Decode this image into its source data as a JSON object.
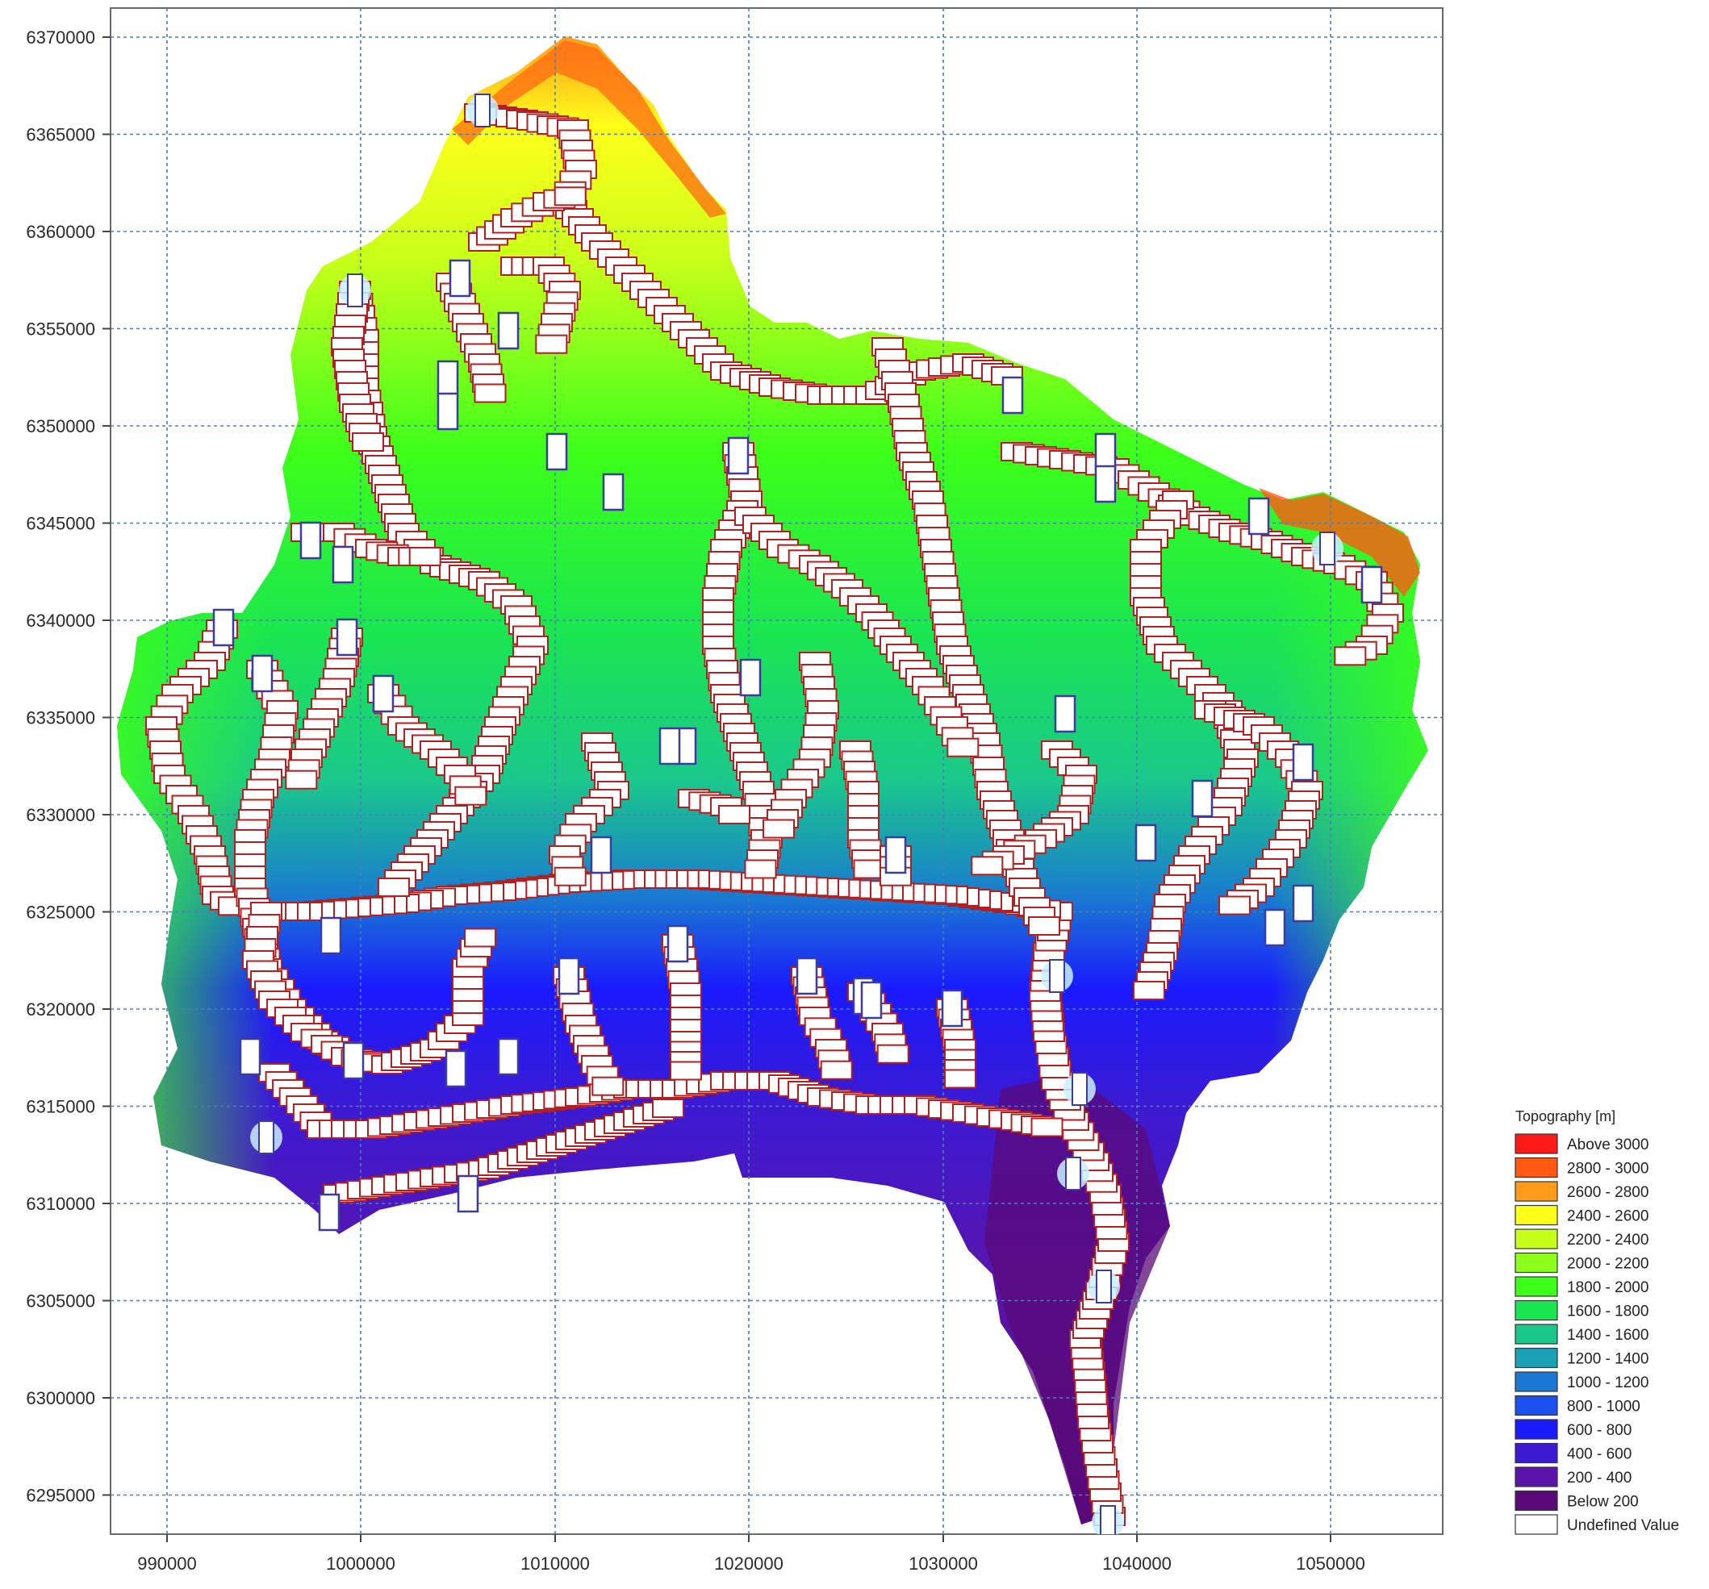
{
  "map": {
    "x_axis": {
      "ticks": [
        "990000",
        "1000000",
        "1010000",
        "1020000",
        "1030000",
        "1040000",
        "1050000"
      ]
    },
    "y_axis": {
      "ticks": [
        "6370000",
        "6365000",
        "6360000",
        "6355000",
        "6350000",
        "6345000",
        "6340000",
        "6335000",
        "6330000",
        "6325000",
        "6320000",
        "6315000",
        "6310000",
        "6305000",
        "6300000",
        "6295000"
      ]
    },
    "grid": "dashed"
  },
  "legend": {
    "title": "Topography [m]",
    "placement": "bottom-right",
    "items": [
      {
        "label": "Above 3000",
        "color": "#ff1a1a"
      },
      {
        "label": "2800 - 3000",
        "color": "#ff5a14"
      },
      {
        "label": "2600 - 2800",
        "color": "#ff9a1a"
      },
      {
        "label": "2400 - 2600",
        "color": "#ffff1a"
      },
      {
        "label": "2200 - 2400",
        "color": "#c8ff1a"
      },
      {
        "label": "2000 - 2200",
        "color": "#8cff1a"
      },
      {
        "label": "1800 - 2000",
        "color": "#3cff1a"
      },
      {
        "label": "1600 - 1800",
        "color": "#1ae650"
      },
      {
        "label": "1400 - 1600",
        "color": "#1ac88c"
      },
      {
        "label": "1200 - 1400",
        "color": "#1aa0b4"
      },
      {
        "label": "1000 - 1200",
        "color": "#1a78d2"
      },
      {
        "label": "800 - 1000",
        "color": "#1a50f0"
      },
      {
        "label": "600 -   800",
        "color": "#1a1aff"
      },
      {
        "label": "400 -   600",
        "color": "#3c1ad2"
      },
      {
        "label": "200 -   400",
        "color": "#5a14aa"
      },
      {
        "label": "Below   200",
        "color": "#5a0a78"
      },
      {
        "label": "Undefined Value",
        "color": "#ffffff"
      }
    ]
  },
  "network": {
    "segment_fill": "#ffffff",
    "segment_stroke": "#b41e1e",
    "node_stroke": "#3c3ca0",
    "boundary_node_color": "#c8f0ff"
  }
}
